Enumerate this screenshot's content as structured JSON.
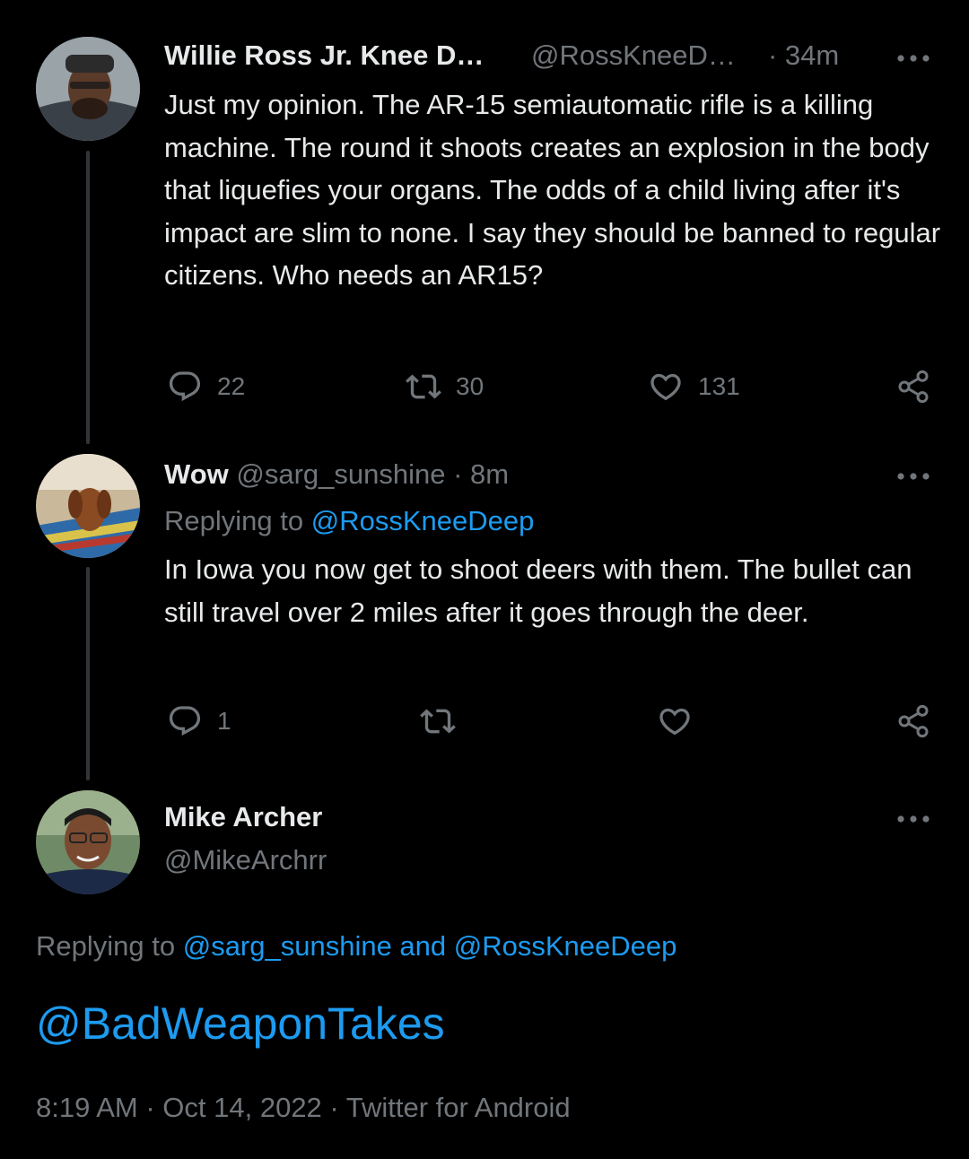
{
  "thread": {
    "tweet1": {
      "author_name": "Willie Ross Jr. Knee D…",
      "handle": "@RossKneeD…",
      "time": "· 34m",
      "body": "Just my opinion. The AR-15 semiautomatic rifle is a killing machine. The round it shoots creates an explosion in the body that liquefies your organs. The odds of a child living after it's impact are slim to none. I say they should be banned to regular citizens. Who needs an AR15?",
      "replies": "22",
      "retweets": "30",
      "likes": "131"
    },
    "tweet2": {
      "author_name": "Wow",
      "handle_time": "@sarg_sunshine · 8m",
      "replying_prefix": "Replying to ",
      "replying_handle": "@RossKneeDeep",
      "body": "In Iowa you now get to shoot deers with them. The bullet can still travel over 2 miles after it goes through the deer.",
      "replies": "1"
    },
    "main_tweet": {
      "author_name": "Mike Archer",
      "handle": "@MikeArchrr",
      "replying_prefix": "Replying to ",
      "replying_handles": "@sarg_sunshine and @RossKneeDeep",
      "body": "@BadWeaponTakes",
      "timestamp": "8:19 AM · Oct 14, 2022 · Twitter for Android"
    }
  },
  "icons": [
    "reply-icon",
    "retweet-icon",
    "like-icon",
    "share-icon",
    "more-icon"
  ],
  "colors": {
    "background": "#000000",
    "text": "#e7e9ea",
    "muted": "#71767b",
    "link": "#1d9bf0"
  }
}
